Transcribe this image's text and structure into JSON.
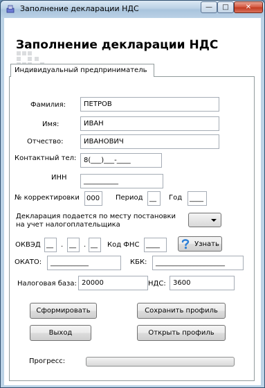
{
  "window": {
    "title": "Заполнение декларации НДС",
    "minimize_glyph": "—",
    "maximize_glyph": "□",
    "close_glyph": "✕"
  },
  "form": {
    "heading": "Заполнение декларации НДС",
    "tab_label": "Индивидуальный предприниматель",
    "fields": {
      "surname": {
        "label": "Фамилия:",
        "value": "ПЕТРОВ"
      },
      "name": {
        "label": "Имя:",
        "value": "ИВАН"
      },
      "patronymic": {
        "label": "Отчество:",
        "value": "ИВАНОВИЧ"
      },
      "phone": {
        "label": "Контактный тел:",
        "value": "8(___)___-____"
      },
      "inn": {
        "label": "ИНН",
        "value": "__________"
      },
      "correction_no": {
        "label": "№ корректировки",
        "value": "000"
      },
      "period": {
        "label": "Период",
        "value": "__"
      },
      "year": {
        "label": "Год",
        "value": "____"
      },
      "declaration_place": {
        "label_line1": "Декларация подается по месту постановки",
        "label_line2": "на учет налогоплательщика",
        "value": ""
      },
      "okved": {
        "label": "ОКВЭД",
        "part1": "__",
        "dot1": ".",
        "part2": "__",
        "dot2": ".",
        "part3": "__"
      },
      "fns_code": {
        "label": "Код ФНС",
        "value": "____"
      },
      "okato": {
        "label": "ОКАТО:",
        "value": "___________"
      },
      "kbk": {
        "label": "КБК:",
        "value": "____________________"
      },
      "tax_base": {
        "label": "Налоговая база:",
        "value": "20000"
      },
      "vat": {
        "label": "НДС:",
        "value": "3600"
      }
    },
    "buttons": {
      "find_out": "Узнать",
      "generate": "Сформировать",
      "save_profile": "Сохранить профиль",
      "exit": "Выход",
      "open_profile": "Открыть профиль"
    },
    "progress": {
      "label": "Прогресс:",
      "value": 0
    }
  },
  "icons": {
    "app": "app-icon",
    "help": "question-icon"
  },
  "colors": {
    "titlebar": "#bcd3e6",
    "close_button": "#c23a20",
    "help_icon": "#2d7fd6"
  }
}
